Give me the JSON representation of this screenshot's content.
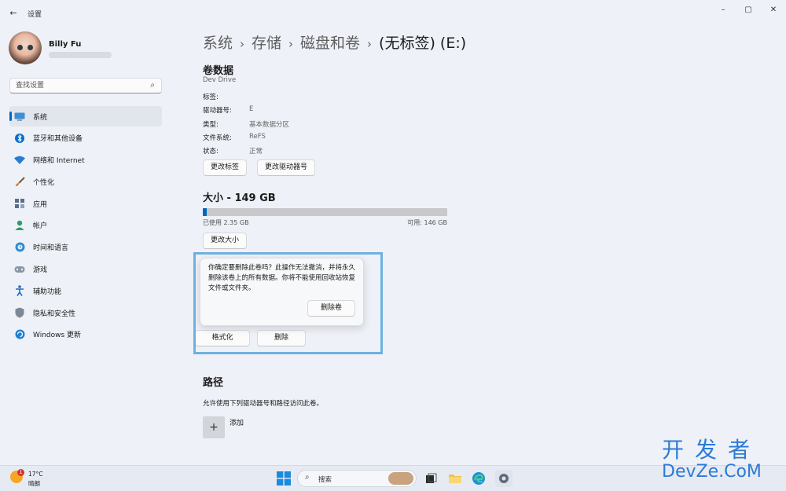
{
  "window": {
    "back_glyph": "←",
    "title": "设置",
    "minimize_glyph": "–",
    "maximize_glyph": "▢",
    "close_glyph": "✕"
  },
  "user": {
    "name": "Billy Fu"
  },
  "search": {
    "placeholder": "查找设置",
    "icon": "search-icon",
    "icon_glyph": "⌕"
  },
  "nav": {
    "items": [
      {
        "label": "系统",
        "icon": "system-icon",
        "active": true
      },
      {
        "label": "蓝牙和其他设备",
        "icon": "bluetooth-icon"
      },
      {
        "label": "网络和 Internet",
        "icon": "wifi-icon"
      },
      {
        "label": "个性化",
        "icon": "brush-icon"
      },
      {
        "label": "应用",
        "icon": "apps-icon"
      },
      {
        "label": "帐户",
        "icon": "account-icon"
      },
      {
        "label": "时间和语言",
        "icon": "clock-globe-icon"
      },
      {
        "label": "游戏",
        "icon": "gamepad-icon"
      },
      {
        "label": "辅助功能",
        "icon": "accessibility-icon"
      },
      {
        "label": "隐私和安全性",
        "icon": "shield-icon"
      },
      {
        "label": "Windows 更新",
        "icon": "update-icon"
      }
    ]
  },
  "breadcrumb": {
    "items": [
      "系统",
      "存储",
      "磁盘和卷"
    ],
    "separator": "›",
    "current": "(无标签) (E:)"
  },
  "volume": {
    "title": "卷数据",
    "subtitle": "Dev Drive",
    "fields": [
      {
        "label": "标签:",
        "value": ""
      },
      {
        "label": "驱动器号:",
        "value": "E"
      },
      {
        "label": "类型:",
        "value": "基本数据分区"
      },
      {
        "label": "文件系统:",
        "value": "ReFS"
      },
      {
        "label": "状态:",
        "value": "正常"
      }
    ],
    "change_label_button": "更改标签",
    "change_letter_button": "更改驱动器号"
  },
  "size": {
    "title": "大小 - 149 GB",
    "used_text": "已使用 2.35 GB",
    "free_text": "可用: 146 GB",
    "used_fraction": 0.016,
    "accent_color": "#0067c0",
    "resize_button": "更改大小"
  },
  "delete_flyout": {
    "message": "你确定要删除此卷吗？此操作无法撤消，并将永久删除该卷上的所有数据。你将不能使用回收站恢复文件或文件夹。",
    "confirm_button": "删除卷",
    "highlight_color": "#6fb0de"
  },
  "actions": {
    "format_button": "格式化",
    "delete_button": "删除"
  },
  "path": {
    "title": "路径",
    "description": "允许使用下列驱动器号和路径访问此卷。",
    "add_glyph": "+",
    "add_label": "添加"
  },
  "taskbar": {
    "weather_temp": "17°C",
    "weather_condition": "晴朗",
    "weather_badge": "1",
    "search_icon_glyph": "⌕",
    "search_label": "搜索",
    "apps": [
      "start-icon",
      "task-view-icon",
      "file-explorer-icon",
      "edge-icon",
      "settings-icon"
    ]
  },
  "watermark": {
    "line1": "开发者",
    "line2": "DevZe.CoM"
  }
}
